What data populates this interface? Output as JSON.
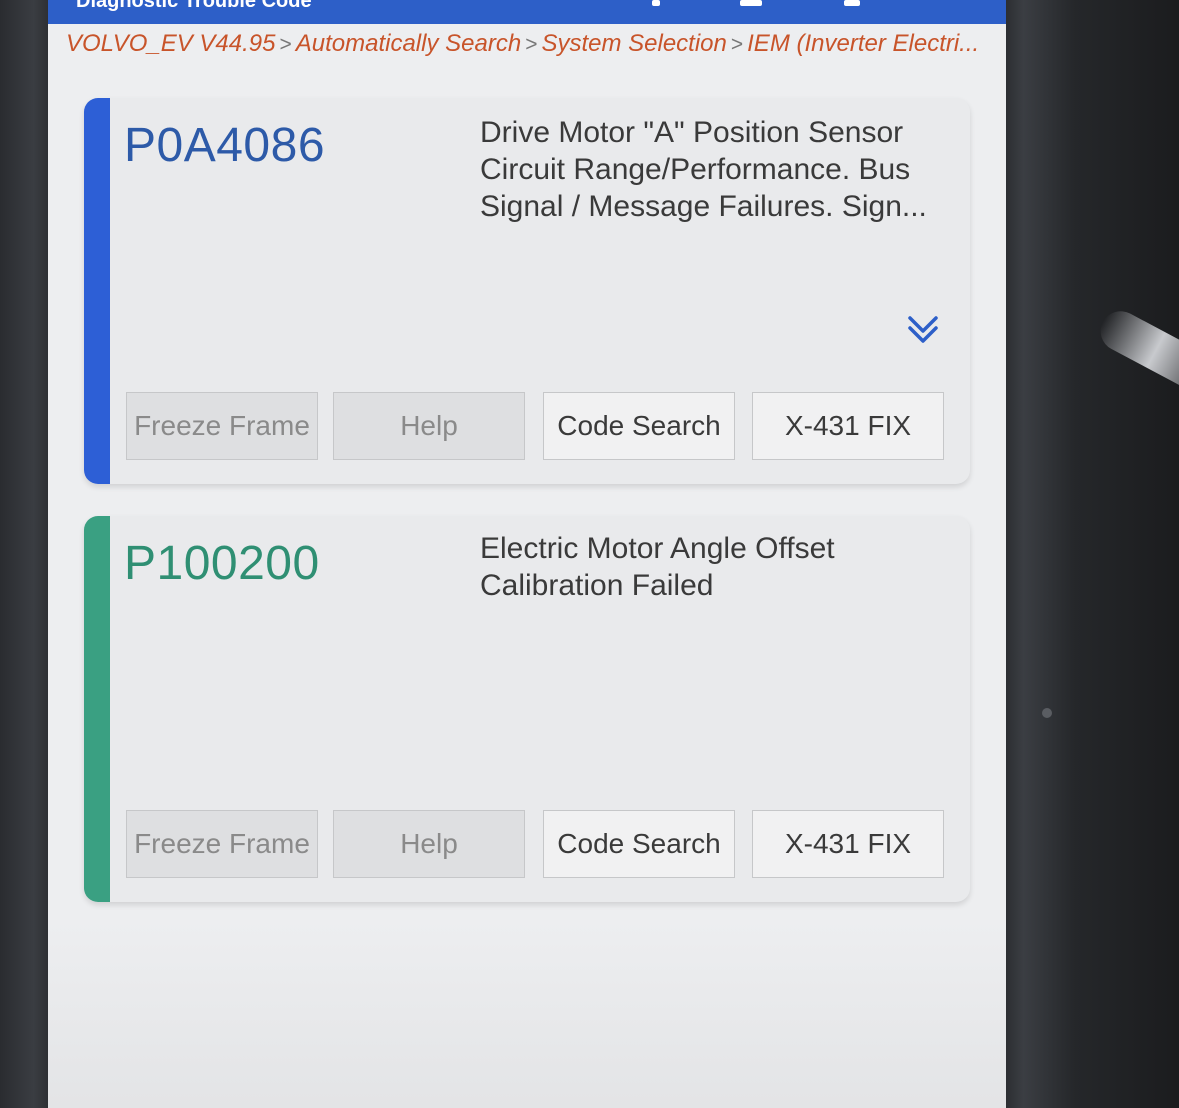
{
  "header": {
    "title": "Diagnostic Trouble Code",
    "bar_color": "#2d5fc8"
  },
  "breadcrumb": {
    "items": [
      "VOLVO_EV V44.95",
      "Automatically Search",
      "System Selection",
      "IEM (Inverter Electri..."
    ],
    "separator": ">"
  },
  "dtc_list": [
    {
      "code": "P0A4086",
      "description": "Drive Motor \"A\" Position Sensor Circuit Range/Performance. Bus Signal / Message Failures. Sign...",
      "accent_color": "#2d5fd6",
      "buttons": {
        "freeze_frame": "Freeze Frame",
        "help": "Help",
        "code_search": "Code Search",
        "fix": "X-431 FIX"
      },
      "expand_icon": "double-chevron-down-icon"
    },
    {
      "code": "P100200",
      "description": "Electric Motor Angle Offset Calibration Failed",
      "accent_color": "#3aa082",
      "buttons": {
        "freeze_frame": "Freeze Frame",
        "help": "Help",
        "code_search": "Code Search",
        "fix": "X-431 FIX"
      }
    }
  ]
}
